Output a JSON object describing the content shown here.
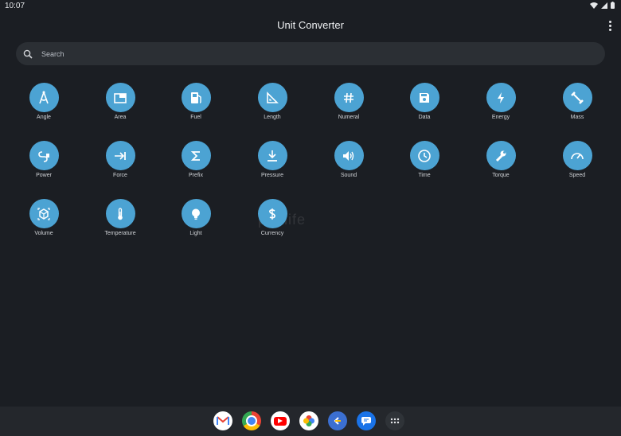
{
  "status": {
    "time": "10:07"
  },
  "header": {
    "title": "Unit Converter"
  },
  "search": {
    "placeholder": "Search"
  },
  "converters": [
    {
      "label": "Angle",
      "icon": "angle-icon"
    },
    {
      "label": "Area",
      "icon": "area-icon"
    },
    {
      "label": "Fuel",
      "icon": "fuel-icon"
    },
    {
      "label": "Length",
      "icon": "length-icon"
    },
    {
      "label": "Numeral",
      "icon": "hash-icon"
    },
    {
      "label": "Data",
      "icon": "floppy-icon"
    },
    {
      "label": "Energy",
      "icon": "bolt-icon"
    },
    {
      "label": "Mass",
      "icon": "weight-icon"
    },
    {
      "label": "Power",
      "icon": "plug-icon"
    },
    {
      "label": "Force",
      "icon": "arrow-bar-icon"
    },
    {
      "label": "Prefix",
      "icon": "sigma-icon"
    },
    {
      "label": "Pressure",
      "icon": "pressure-icon"
    },
    {
      "label": "Sound",
      "icon": "speaker-icon"
    },
    {
      "label": "Time",
      "icon": "clock-icon"
    },
    {
      "label": "Torque",
      "icon": "wrench-icon"
    },
    {
      "label": "Speed",
      "icon": "gauge-icon"
    },
    {
      "label": "Volume",
      "icon": "cube-icon"
    },
    {
      "label": "Temperature",
      "icon": "thermometer-icon"
    },
    {
      "label": "Light",
      "icon": "bulb-icon"
    },
    {
      "label": "Currency",
      "icon": "dollar-icon"
    }
  ],
  "dock": [
    "gmail-icon",
    "chrome-icon",
    "youtube-icon",
    "photos-icon",
    "back-app-icon",
    "messages-icon",
    "app-drawer-icon"
  ],
  "colors": {
    "background": "#1b1e23",
    "accent": "#4ca3d3",
    "search_bg": "#2b2f34"
  },
  "watermark": "pdalife"
}
